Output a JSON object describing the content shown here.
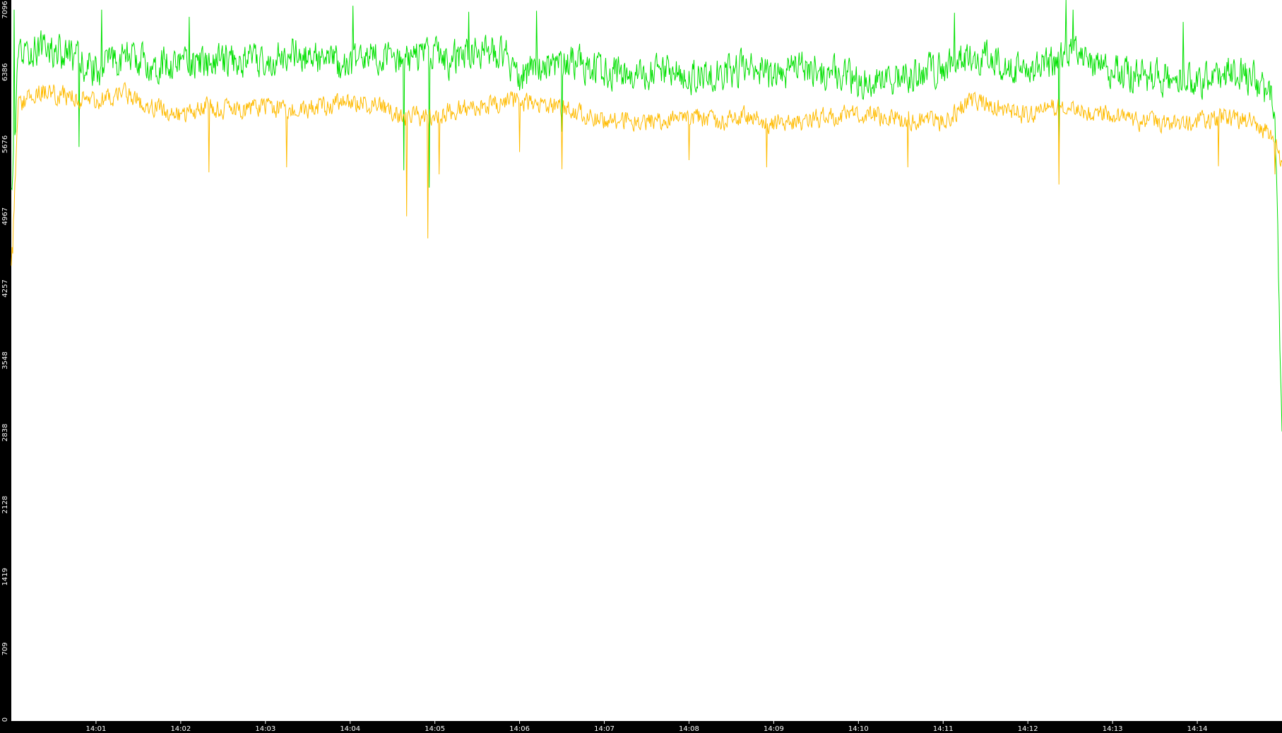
{
  "colors": {
    "background": "#000000",
    "plot_background": "#ffffff",
    "axis_text": "#ffffff",
    "series_1": "#00e000",
    "series_2": "#ffbb00"
  },
  "chart_data": {
    "type": "line",
    "title": "",
    "xlabel": "",
    "ylabel": "",
    "grid": false,
    "legend": "none",
    "xlim": [
      "14:00:00",
      "14:15:00"
    ],
    "ylim": [
      0,
      7096
    ],
    "x_ticks": [
      "14:01",
      "14:02",
      "14:03",
      "14:04",
      "14:05",
      "14:06",
      "14:07",
      "14:08",
      "14:09",
      "14:10",
      "14:11",
      "14:12",
      "14:13",
      "14:14"
    ],
    "y_ticks": [
      "0",
      "709",
      "1419",
      "2128",
      "2838",
      "3548",
      "4257",
      "4967",
      "5676",
      "6386",
      "7096"
    ],
    "series": [
      {
        "color": "#00e000",
        "points": [
          [
            "14:00:00",
            5100
          ],
          [
            "14:00:05",
            6500
          ],
          [
            "14:00:20",
            6650
          ],
          [
            "14:00:40",
            6550
          ],
          [
            "14:01:00",
            6400
          ],
          [
            "14:01:20",
            6550
          ],
          [
            "14:01:40",
            6450
          ],
          [
            "14:02:00",
            6500
          ],
          [
            "14:02:20",
            6450
          ],
          [
            "14:02:40",
            6520
          ],
          [
            "14:03:00",
            6480
          ],
          [
            "14:03:20",
            6560
          ],
          [
            "14:03:40",
            6500
          ],
          [
            "14:04:00",
            6450
          ],
          [
            "14:04:20",
            6550
          ],
          [
            "14:04:40",
            6500
          ],
          [
            "14:04:55",
            6600
          ],
          [
            "14:05:10",
            6500
          ],
          [
            "14:05:30",
            6600
          ],
          [
            "14:05:50",
            6550
          ],
          [
            "14:06:00",
            6350
          ],
          [
            "14:06:20",
            6450
          ],
          [
            "14:06:40",
            6500
          ],
          [
            "14:07:00",
            6380
          ],
          [
            "14:07:20",
            6350
          ],
          [
            "14:07:40",
            6400
          ],
          [
            "14:08:00",
            6330
          ],
          [
            "14:08:20",
            6380
          ],
          [
            "14:08:40",
            6420
          ],
          [
            "14:09:00",
            6350
          ],
          [
            "14:09:20",
            6450
          ],
          [
            "14:09:40",
            6380
          ],
          [
            "14:10:00",
            6320
          ],
          [
            "14:10:20",
            6300
          ],
          [
            "14:10:40",
            6380
          ],
          [
            "14:11:00",
            6420
          ],
          [
            "14:11:20",
            6550
          ],
          [
            "14:11:40",
            6480
          ],
          [
            "14:12:00",
            6400
          ],
          [
            "14:12:20",
            6480
          ],
          [
            "14:12:30",
            6600
          ],
          [
            "14:12:40",
            6500
          ],
          [
            "14:13:00",
            6400
          ],
          [
            "14:13:20",
            6350
          ],
          [
            "14:13:40",
            6320
          ],
          [
            "14:14:00",
            6300
          ],
          [
            "14:14:20",
            6380
          ],
          [
            "14:14:40",
            6320
          ],
          [
            "14:14:55",
            6050
          ],
          [
            "14:15:00",
            2850
          ]
        ]
      },
      {
        "color": "#ffbb00",
        "points": [
          [
            "14:00:00",
            4500
          ],
          [
            "14:00:05",
            6050
          ],
          [
            "14:00:20",
            6200
          ],
          [
            "14:00:40",
            6150
          ],
          [
            "14:01:00",
            6100
          ],
          [
            "14:01:20",
            6180
          ],
          [
            "14:01:40",
            6050
          ],
          [
            "14:02:00",
            5950
          ],
          [
            "14:02:20",
            6050
          ],
          [
            "14:02:40",
            6000
          ],
          [
            "14:03:00",
            6050
          ],
          [
            "14:03:20",
            6000
          ],
          [
            "14:03:40",
            6050
          ],
          [
            "14:04:00",
            6100
          ],
          [
            "14:04:20",
            6050
          ],
          [
            "14:04:40",
            5950
          ],
          [
            "14:04:55",
            5950
          ],
          [
            "14:05:10",
            6000
          ],
          [
            "14:05:30",
            6050
          ],
          [
            "14:05:50",
            6080
          ],
          [
            "14:06:00",
            6100
          ],
          [
            "14:06:20",
            6050
          ],
          [
            "14:06:40",
            6000
          ],
          [
            "14:07:00",
            5900
          ],
          [
            "14:07:20",
            5920
          ],
          [
            "14:07:40",
            5900
          ],
          [
            "14:08:00",
            5950
          ],
          [
            "14:08:20",
            5900
          ],
          [
            "14:08:40",
            5950
          ],
          [
            "14:09:00",
            5880
          ],
          [
            "14:09:20",
            5900
          ],
          [
            "14:09:40",
            5950
          ],
          [
            "14:10:00",
            5980
          ],
          [
            "14:10:20",
            5950
          ],
          [
            "14:10:40",
            5920
          ],
          [
            "14:11:00",
            5900
          ],
          [
            "14:11:20",
            6100
          ],
          [
            "14:11:40",
            6050
          ],
          [
            "14:12:00",
            5950
          ],
          [
            "14:12:20",
            6050
          ],
          [
            "14:12:30",
            6050
          ],
          [
            "14:12:40",
            6000
          ],
          [
            "14:13:00",
            5950
          ],
          [
            "14:13:20",
            5900
          ],
          [
            "14:13:40",
            5880
          ],
          [
            "14:14:00",
            5900
          ],
          [
            "14:14:20",
            5950
          ],
          [
            "14:14:40",
            5900
          ],
          [
            "14:14:55",
            5700
          ],
          [
            "14:15:00",
            5500
          ]
        ]
      }
    ],
    "dips": [
      {
        "series": 1,
        "x": "14:00:01",
        "y": 4600
      },
      {
        "series": 0,
        "x": "14:00:48",
        "y": 5650
      },
      {
        "series": 1,
        "x": "14:02:20",
        "y": 5400
      },
      {
        "series": 1,
        "x": "14:03:15",
        "y": 5450
      },
      {
        "series": 1,
        "x": "14:04:40",
        "y": 4967
      },
      {
        "series": 0,
        "x": "14:04:38",
        "y": 5420
      },
      {
        "series": 1,
        "x": "14:04:55",
        "y": 4750
      },
      {
        "series": 0,
        "x": "14:04:56",
        "y": 5250
      },
      {
        "series": 1,
        "x": "14:05:03",
        "y": 5380
      },
      {
        "series": 1,
        "x": "14:06:00",
        "y": 5600
      },
      {
        "series": 1,
        "x": "14:06:30",
        "y": 5430
      },
      {
        "series": 0,
        "x": "14:06:30",
        "y": 5800
      },
      {
        "series": 1,
        "x": "14:08:00",
        "y": 5520
      },
      {
        "series": 1,
        "x": "14:08:55",
        "y": 5450
      },
      {
        "series": 1,
        "x": "14:10:35",
        "y": 5450
      },
      {
        "series": 1,
        "x": "14:12:22",
        "y": 5280
      },
      {
        "series": 0,
        "x": "14:12:22",
        "y": 5650
      },
      {
        "series": 1,
        "x": "14:14:15",
        "y": 5460
      },
      {
        "series": 1,
        "x": "14:14:55",
        "y": 5380
      }
    ],
    "peaks": [
      {
        "series": 0,
        "x": "14:00:02",
        "y": 7000
      },
      {
        "series": 0,
        "x": "14:01:04",
        "y": 7000
      },
      {
        "series": 0,
        "x": "14:02:06",
        "y": 6930
      },
      {
        "series": 0,
        "x": "14:04:02",
        "y": 7040
      },
      {
        "series": 0,
        "x": "14:05:24",
        "y": 6980
      },
      {
        "series": 0,
        "x": "14:06:12",
        "y": 6990
      },
      {
        "series": 0,
        "x": "14:11:08",
        "y": 6970
      },
      {
        "series": 0,
        "x": "14:12:27",
        "y": 7096
      },
      {
        "series": 0,
        "x": "14:12:32",
        "y": 7000
      },
      {
        "series": 0,
        "x": "14:13:50",
        "y": 6880
      }
    ]
  }
}
